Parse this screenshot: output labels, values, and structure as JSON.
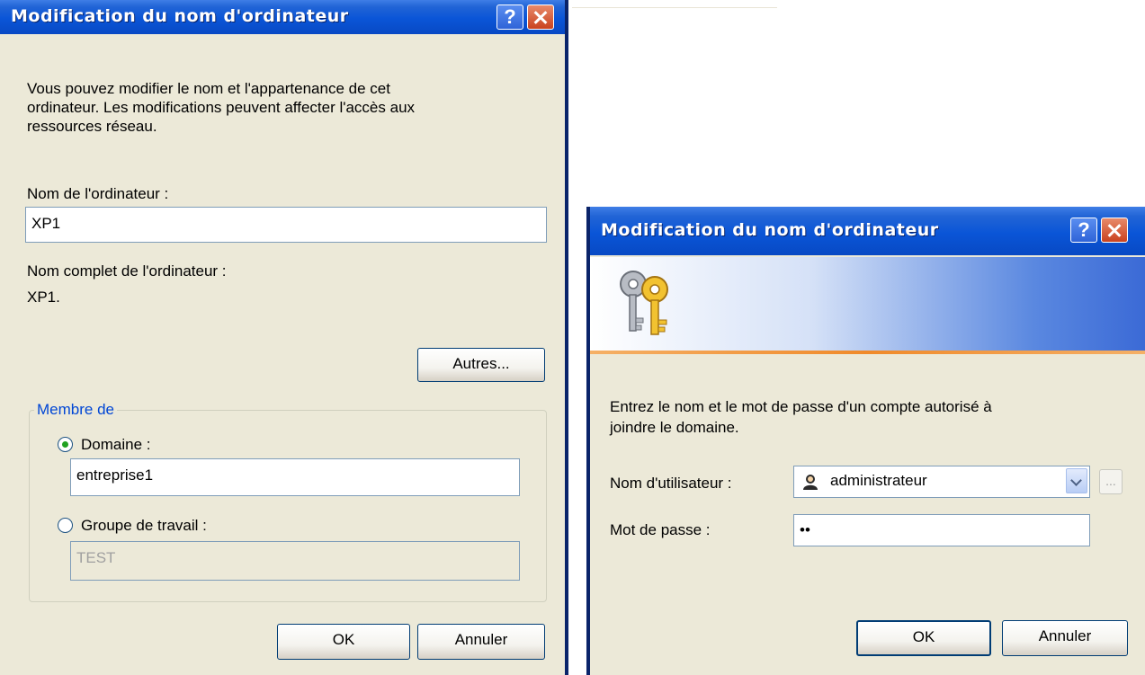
{
  "dialog1": {
    "title": "Modification du nom d'ordinateur",
    "help_glyph": "?",
    "intro": [
      "Vous pouvez modifier le nom et l'appartenance de cet",
      "ordinateur. Les modifications peuvent affecter l'accès aux",
      "ressources réseau."
    ],
    "computer_name_label": "Nom de l'ordinateur :",
    "computer_name_value": "XP1",
    "full_name_label": "Nom complet de l'ordinateur :",
    "full_name_value": "XP1.",
    "more_button": "Autres...",
    "member_of": {
      "legend": "Membre de",
      "domain_label": "Domaine :",
      "domain_value": "entreprise1",
      "domain_selected": true,
      "workgroup_label": "Groupe de travail :",
      "workgroup_value": "TEST",
      "workgroup_selected": false
    },
    "ok_button": "OK",
    "cancel_button": "Annuler"
  },
  "dialog2": {
    "title": "Modification du nom d'ordinateur",
    "help_glyph": "?",
    "instruction": [
      "Entrez le nom et le mot de passe d'un compte autorisé à",
      "joindre le domaine."
    ],
    "username_label": "Nom d'utilisateur :",
    "username_value": "administrateur",
    "browse_button": "...",
    "password_label": "Mot de passe :",
    "password_value": "••",
    "ok_button": "OK",
    "cancel_button": "Annuler"
  },
  "icons": {
    "help": "help-icon",
    "close": "close-icon",
    "keys": "keys-icon",
    "user": "user-icon",
    "dropdown": "chevron-down-icon"
  },
  "colors": {
    "titlebar": "#0a55d7",
    "dialog_bg": "#ece9d8",
    "group_legend": "#0046d5",
    "banner_accent": "#f08a2a"
  }
}
